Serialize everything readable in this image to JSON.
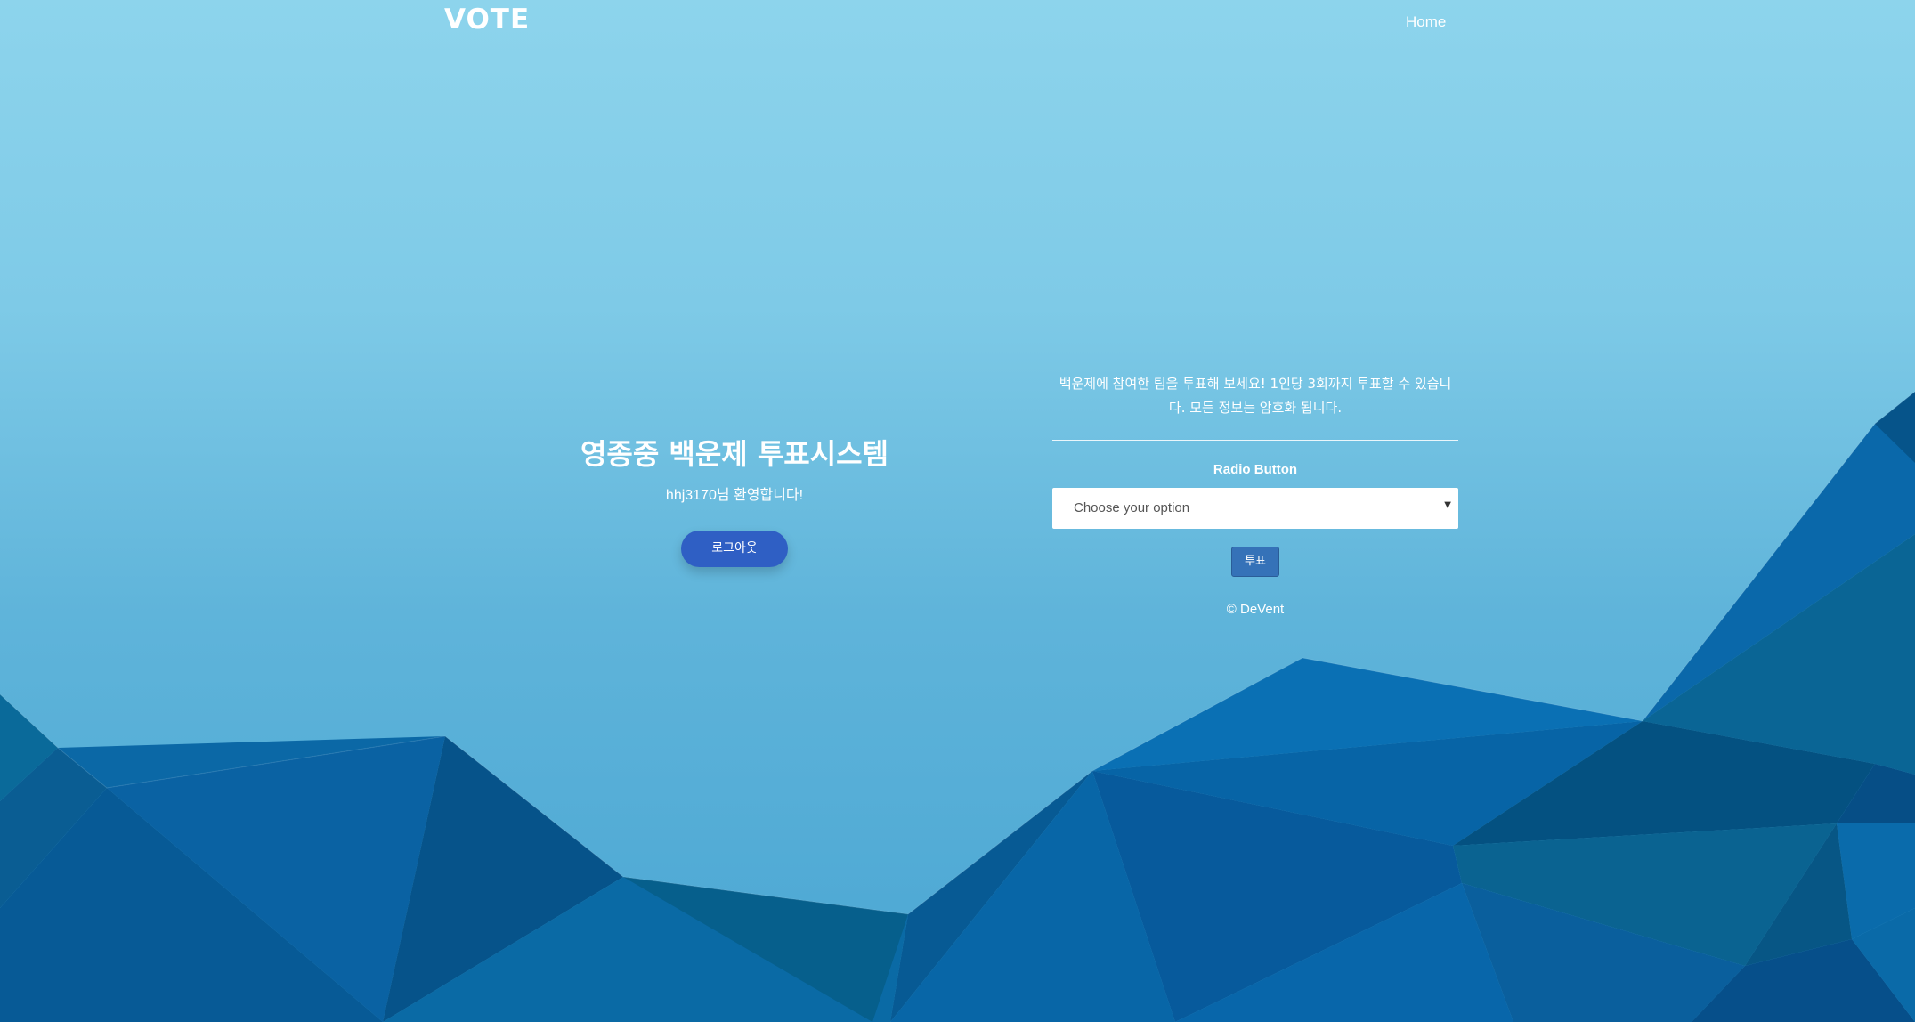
{
  "navbar": {
    "brand": "VOTE",
    "home_link": "Home"
  },
  "hero": {
    "title": "영종중 백운제 투표시스템",
    "welcome": "hhj3170님 환영합니다!",
    "logout_label": "로그아웃"
  },
  "vote_form": {
    "intro": "백운제에 참여한 팀을 투표해 보세요! 1인당 3회까지 투표할 수 있습니다. 모든 정보는 암호화 됩니다.",
    "section_label": "Radio Button",
    "select_placeholder": "Choose your option",
    "submit_label": "투표"
  },
  "footer": {
    "copyright": "© DeVent"
  },
  "colors": {
    "sky_top": "#8dd4ec",
    "sky_bottom": "#4aa6d3",
    "logout_button": "#2f5fc4",
    "vote_button": "#3572b8"
  }
}
